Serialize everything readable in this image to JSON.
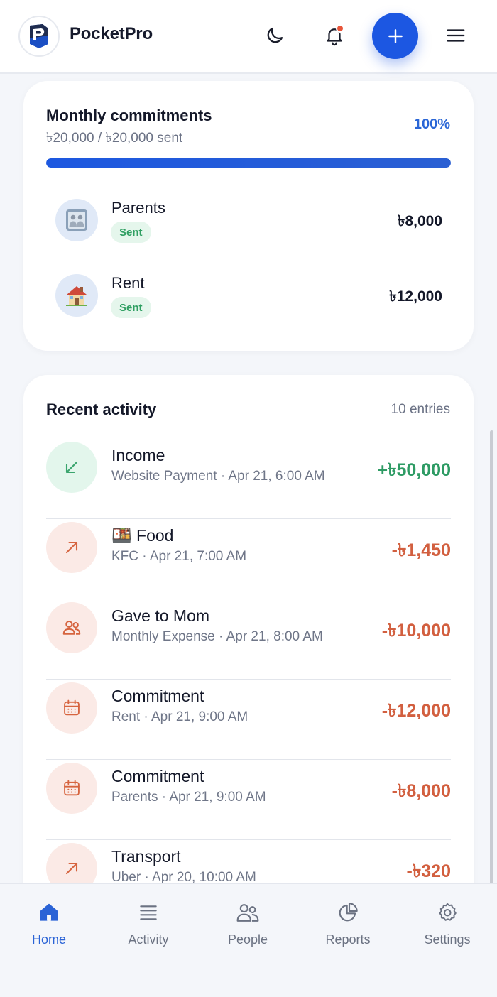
{
  "app": {
    "name": "PocketPro"
  },
  "header": {
    "icons": [
      "moon-icon",
      "bell-icon",
      "plus-icon",
      "menu-icon"
    ],
    "notification_dot": true
  },
  "colors": {
    "accent": "#1c57e2",
    "positive": "#2e9b64",
    "negative": "#d25f3f",
    "badge_bg": "#e5f6ec",
    "badge_text": "#2f9f62"
  },
  "commitments": {
    "title": "Monthly commitments",
    "subtitle": "৳20,000 / ৳20,000 sent",
    "percent_label": "100%",
    "progress": 1.0,
    "items": [
      {
        "name": "Parents",
        "emoji": "🖼️",
        "status": "Sent",
        "amount": "৳8,000"
      },
      {
        "name": "Rent",
        "emoji": "🏠",
        "status": "Sent",
        "amount": "৳12,000"
      }
    ]
  },
  "activity": {
    "title": "Recent activity",
    "count": "10 entries",
    "items": [
      {
        "type": "income",
        "icon": "arrow-down-left-icon",
        "title": "Income",
        "subtitle": "Website Payment · Apr 21, 6:00 AM",
        "amount": "+৳50,000"
      },
      {
        "type": "expense",
        "icon": "arrow-up-right-icon",
        "title": "🍱 Food",
        "subtitle": "KFC · Apr 21, 7:00 AM",
        "amount": "-৳1,450"
      },
      {
        "type": "expense",
        "icon": "users-icon",
        "title": "Gave to Mom",
        "subtitle": "Monthly Expense · Apr 21, 8:00 AM",
        "amount": "-৳10,000"
      },
      {
        "type": "expense",
        "icon": "calendar-icon",
        "title": "Commitment",
        "subtitle": "Rent · Apr 21, 9:00 AM",
        "amount": "-৳12,000"
      },
      {
        "type": "expense",
        "icon": "calendar-icon",
        "title": "Commitment",
        "subtitle": "Parents · Apr 21, 9:00 AM",
        "amount": "-৳8,000"
      },
      {
        "type": "expense",
        "icon": "arrow-up-right-icon",
        "title": "Transport",
        "subtitle": "Uber · Apr 20, 10:00 AM",
        "amount": "-৳320"
      }
    ]
  },
  "nav": {
    "items": [
      {
        "label": "Home",
        "icon": "home-icon",
        "active": true
      },
      {
        "label": "Activity",
        "icon": "list-icon",
        "active": false
      },
      {
        "label": "People",
        "icon": "people-icon",
        "active": false
      },
      {
        "label": "Reports",
        "icon": "pie-chart-icon",
        "active": false
      },
      {
        "label": "Settings",
        "icon": "gear-icon",
        "active": false
      }
    ]
  }
}
